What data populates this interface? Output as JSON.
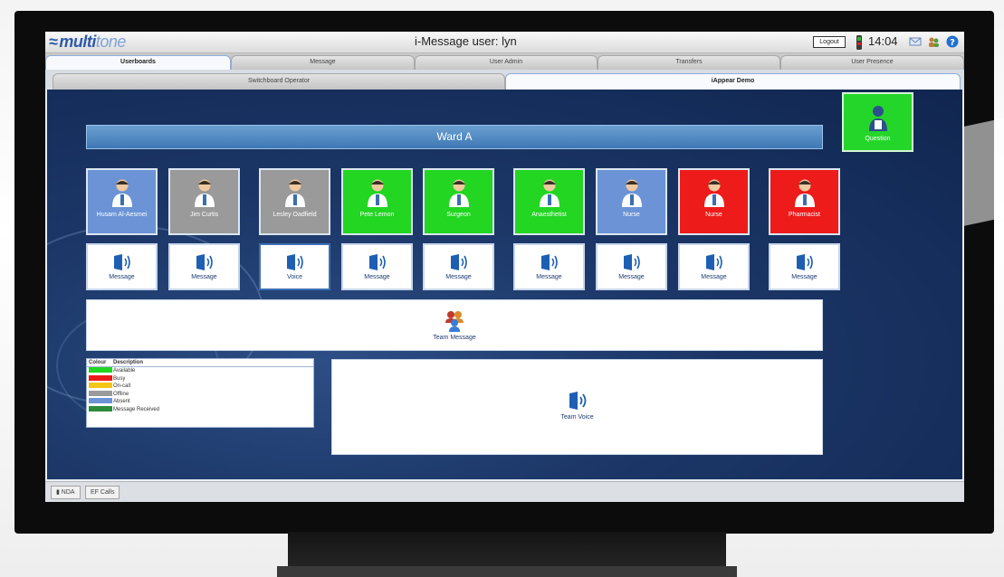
{
  "app": {
    "logo_text": "multi",
    "logo_text_light": "tone",
    "title": "i-Message user: lyn",
    "login_label": "Logout",
    "clock": "14:04"
  },
  "tabs_primary": [
    {
      "label": "Userboards",
      "active": true
    },
    {
      "label": "Message",
      "active": false
    },
    {
      "label": "User Admin",
      "active": false
    },
    {
      "label": "Transfers",
      "active": false
    },
    {
      "label": "User Presence",
      "active": false
    }
  ],
  "tabs_secondary": [
    {
      "label": "Switchboard Operator",
      "active": false
    },
    {
      "label": "iAppear Demo",
      "active": true
    }
  ],
  "ward": {
    "title": "Ward A"
  },
  "question_button": {
    "label": "Question",
    "color": "#25d62a"
  },
  "persons": [
    {
      "name": "Husam Al-Aesmei",
      "status": "Absent",
      "color": "#6b93d6"
    },
    {
      "name": "Jim Curtis",
      "status": "Offline",
      "color": "#9a9a9a"
    },
    {
      "name": "Lesley Oadfield",
      "status": "Offline",
      "color": "#9a9a9a"
    },
    {
      "name": "Pete Lemon",
      "status": "Available",
      "color": "#22d622"
    },
    {
      "name": "Surgeon",
      "status": "Available",
      "color": "#22d622"
    },
    {
      "name": "Anaesthetist",
      "status": "Available",
      "color": "#22d622"
    },
    {
      "name": "Nurse",
      "status": "Absent",
      "color": "#6b93d6"
    },
    {
      "name": "Nurse",
      "status": "Busy",
      "color": "#ee1b1b"
    },
    {
      "name": "Pharmacist",
      "status": "Busy",
      "color": "#ee1b1b"
    }
  ],
  "message_buttons": [
    {
      "label": "Message"
    },
    {
      "label": "Message"
    },
    {
      "label": "Voice"
    },
    {
      "label": "Message"
    },
    {
      "label": "Message"
    },
    {
      "label": "Message"
    },
    {
      "label": "Message"
    },
    {
      "label": "Message"
    },
    {
      "label": "Message"
    }
  ],
  "team_message": {
    "label": "Team Message"
  },
  "team_voice": {
    "label": "Team Voice"
  },
  "legend": {
    "header_colour": "Colour",
    "header_description": "Description",
    "rows": [
      {
        "label": "Available",
        "color": "#22d622"
      },
      {
        "label": "Busy",
        "color": "#ee1b1b"
      },
      {
        "label": "On-call",
        "color": "#f5c518"
      },
      {
        "label": "Offline",
        "color": "#9a9a9a"
      },
      {
        "label": "Absent",
        "color": "#6b93d6"
      },
      {
        "label": "Message Received",
        "color": "#2e8b3a"
      }
    ]
  },
  "status_tabs": [
    {
      "label": "NDA"
    },
    {
      "label": "EF Calls"
    }
  ]
}
